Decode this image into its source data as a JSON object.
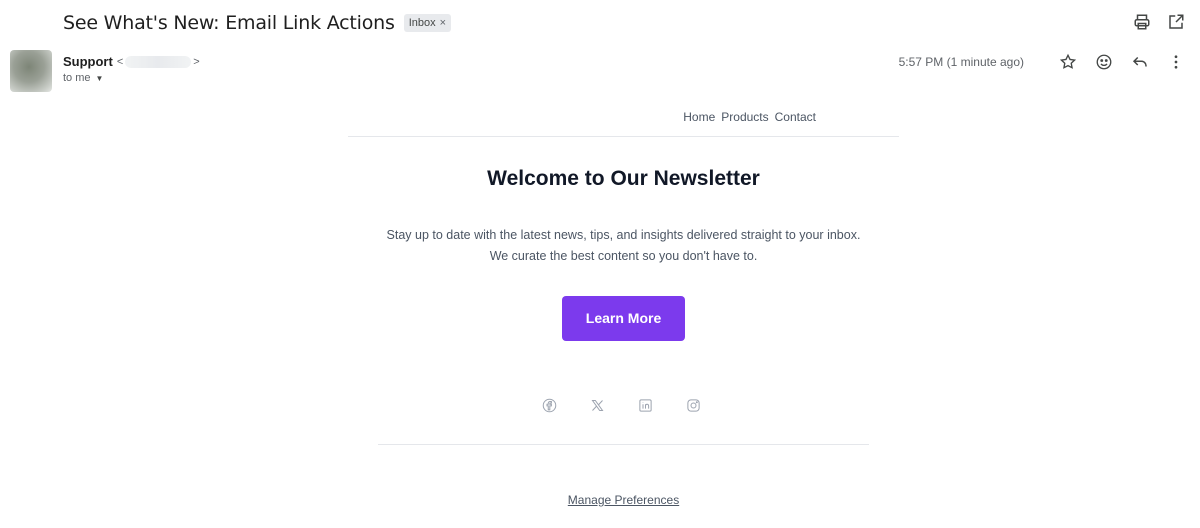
{
  "email": {
    "subject": "See What's New: Email Link Actions",
    "label": "Inbox",
    "label_close": "×",
    "sender_name": "Support",
    "sender_email_open": "<",
    "sender_email_close": ">",
    "recipient": "to me",
    "timestamp": "5:57 PM (1 minute ago)"
  },
  "icons": {
    "print": "print-icon",
    "open_new_window": "open-in-new-icon",
    "star": "star-icon",
    "emoji": "emoji-icon",
    "reply": "reply-icon",
    "more": "more-vert-icon"
  },
  "newsletter": {
    "nav": [
      "Home",
      "Products",
      "Contact"
    ],
    "title": "Welcome to Our Newsletter",
    "body_line1": "Stay up to date with the latest news, tips, and insights delivered straight to your inbox.",
    "body_line2": "We curate the best content so you don't have to.",
    "cta_label": "Learn More",
    "social": [
      "facebook-icon",
      "x-icon",
      "linkedin-icon",
      "instagram-icon"
    ],
    "manage_label": "Manage Preferences"
  },
  "colors": {
    "cta": "#7c3aed",
    "icon_gray": "#9ca3af"
  }
}
